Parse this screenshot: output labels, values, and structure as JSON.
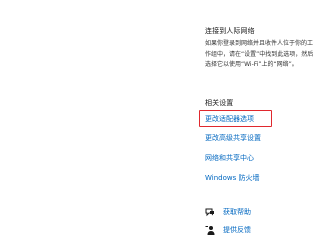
{
  "network_section": {
    "title": "连接到人际网络",
    "description": "如果你登录到网络并且收件人位于你的工作组中，请在“设置”中找到此选项，然后选择它以使用“Wi-Fi”上的“网络”。"
  },
  "related_settings": {
    "title": "相关设置",
    "links": [
      {
        "label": "更改适配器选项",
        "highlighted": true
      },
      {
        "label": "更改高级共享设置",
        "highlighted": false
      },
      {
        "label": "网络和共享中心",
        "highlighted": false
      },
      {
        "label": "Windows 防火墙",
        "highlighted": false
      }
    ]
  },
  "help_links": [
    {
      "label": "获取帮助",
      "icon": "chat-help-icon"
    },
    {
      "label": "提供反馈",
      "icon": "feedback-person-icon"
    }
  ],
  "colors": {
    "link": "#0067c0",
    "highlight_border": "#e0282e"
  }
}
